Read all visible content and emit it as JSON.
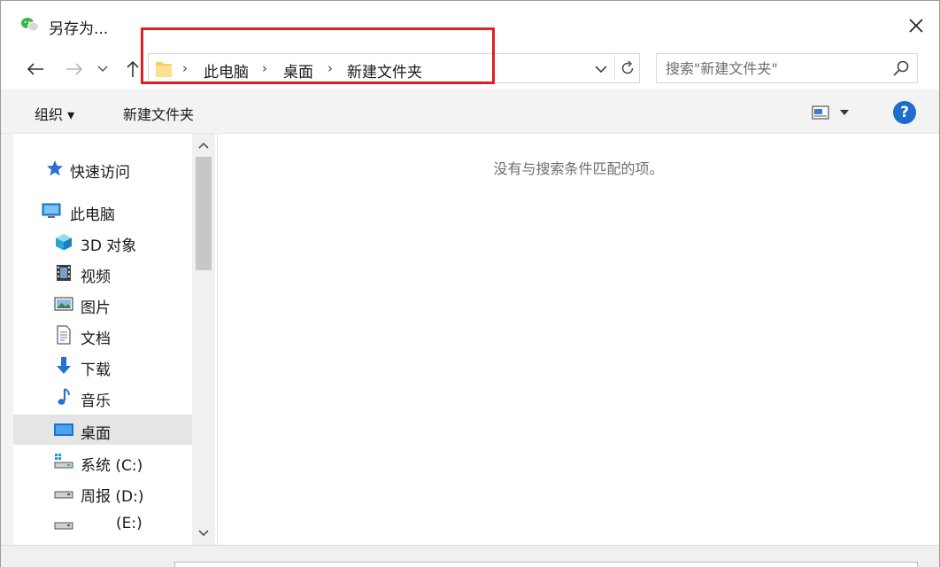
{
  "window": {
    "title": "另存为..."
  },
  "nav": {
    "breadcrumbs": [
      "此电脑",
      "桌面",
      "新建文件夹"
    ]
  },
  "search": {
    "placeholder": "搜索\"新建文件夹\""
  },
  "toolbar": {
    "organize_label": "组织 ▾",
    "new_folder_label": "新建文件夹"
  },
  "sidebar": {
    "items": [
      {
        "label": "快速访问",
        "icon": "star-icon"
      },
      {
        "label": "此电脑",
        "icon": "computer-icon"
      },
      {
        "label": "3D 对象",
        "icon": "cube-icon"
      },
      {
        "label": "视频",
        "icon": "film-icon"
      },
      {
        "label": "图片",
        "icon": "picture-icon"
      },
      {
        "label": "文档",
        "icon": "document-icon"
      },
      {
        "label": "下载",
        "icon": "download-icon"
      },
      {
        "label": "音乐",
        "icon": "music-icon"
      },
      {
        "label": "桌面",
        "icon": "desktop-icon",
        "selected": true
      },
      {
        "label": "系统 (C:)",
        "icon": "system-drive-icon"
      },
      {
        "label": "周报 (D:)",
        "icon": "drive-icon"
      },
      {
        "label": "(E:)",
        "icon": "drive-icon"
      }
    ]
  },
  "content": {
    "empty_message": "没有与搜索条件匹配的项。"
  },
  "colors": {
    "highlight": "#e02020",
    "accent": "#1e6ccc",
    "selected_bg": "#e5e5e5"
  }
}
